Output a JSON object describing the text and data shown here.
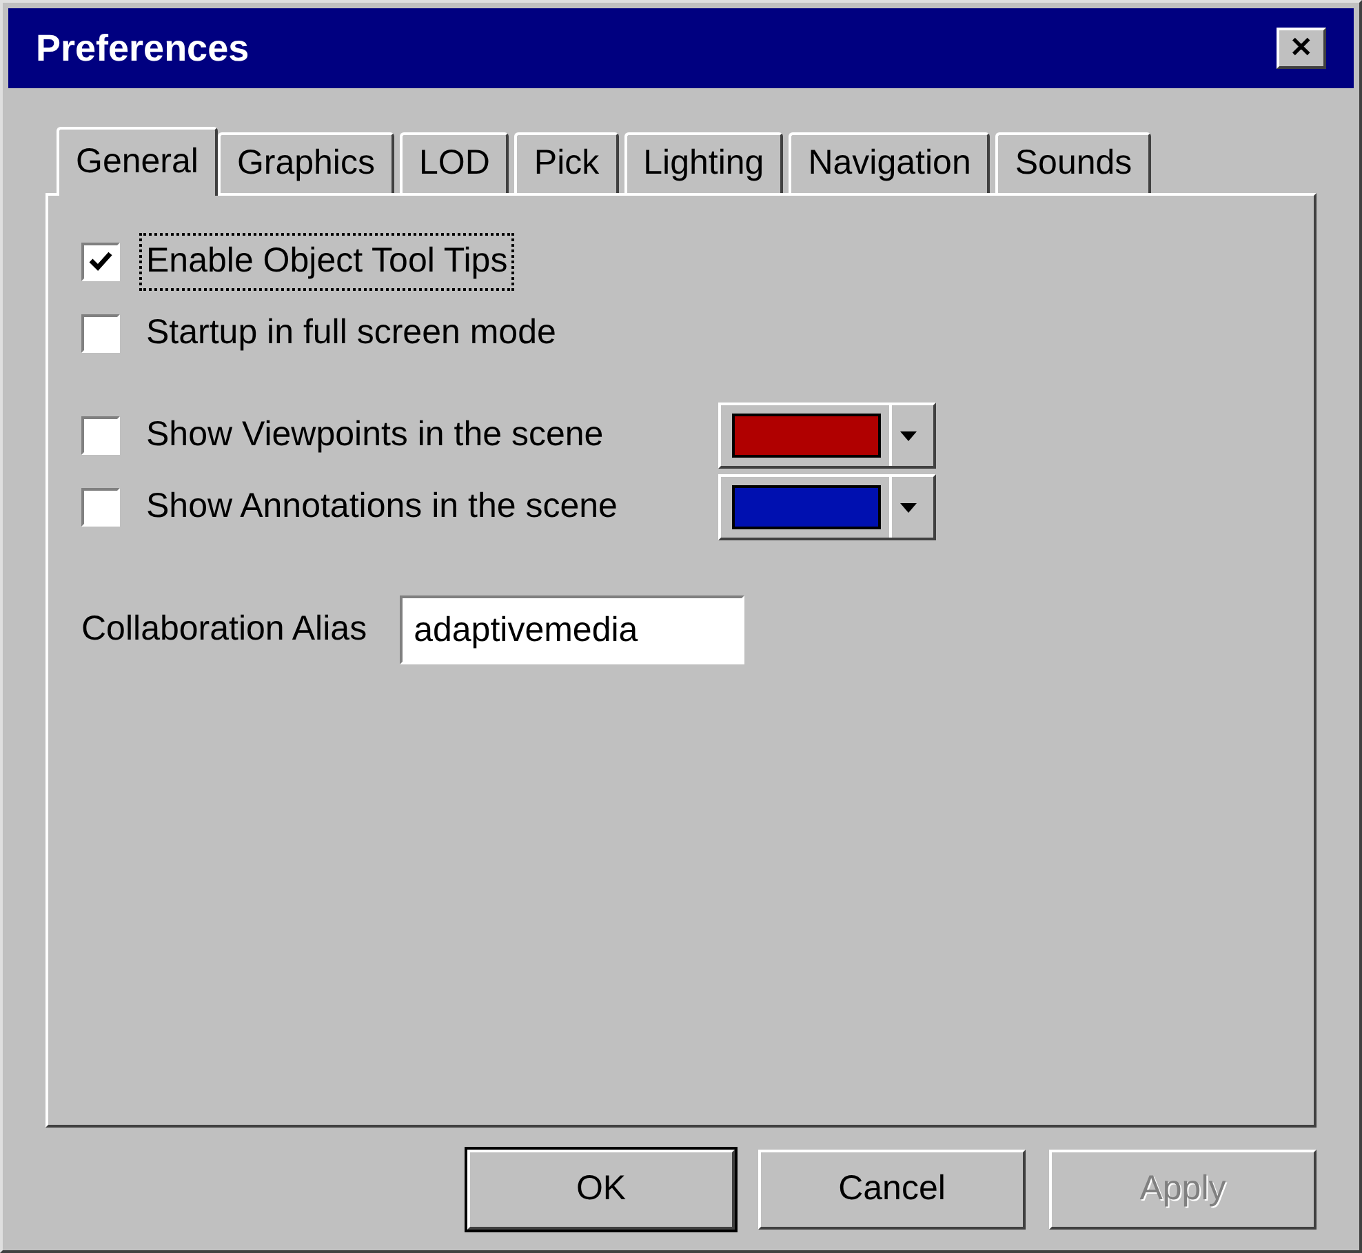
{
  "window": {
    "title": "Preferences",
    "close": "✕"
  },
  "tabs": [
    {
      "label": "General",
      "selected": true
    },
    {
      "label": "Graphics",
      "selected": false
    },
    {
      "label": "LOD",
      "selected": false
    },
    {
      "label": "Pick",
      "selected": false
    },
    {
      "label": "Lighting",
      "selected": false
    },
    {
      "label": "Navigation",
      "selected": false
    },
    {
      "label": "Sounds",
      "selected": false
    }
  ],
  "options": [
    {
      "kind": "checkbox",
      "label": "Enable Object Tool Tips",
      "checked": true,
      "focused": true
    },
    {
      "kind": "checkbox",
      "label": "Startup in full screen mode",
      "checked": false,
      "focused": false
    },
    {
      "kind": "spacer"
    },
    {
      "kind": "color",
      "label": "Show Viewpoints in the scene",
      "checked": false,
      "focused": false,
      "color": "#b00000"
    },
    {
      "kind": "color",
      "label": "Show Annotations in the scene",
      "checked": false,
      "focused": false,
      "color": "#0010b0"
    }
  ],
  "alias": {
    "label": "Collaboration Alias",
    "value": "adaptivemedia"
  },
  "buttons": [
    {
      "label": "OK",
      "default": true,
      "disabled": false
    },
    {
      "label": "Cancel",
      "default": false,
      "disabled": false
    },
    {
      "label": "Apply",
      "default": false,
      "disabled": true
    }
  ]
}
